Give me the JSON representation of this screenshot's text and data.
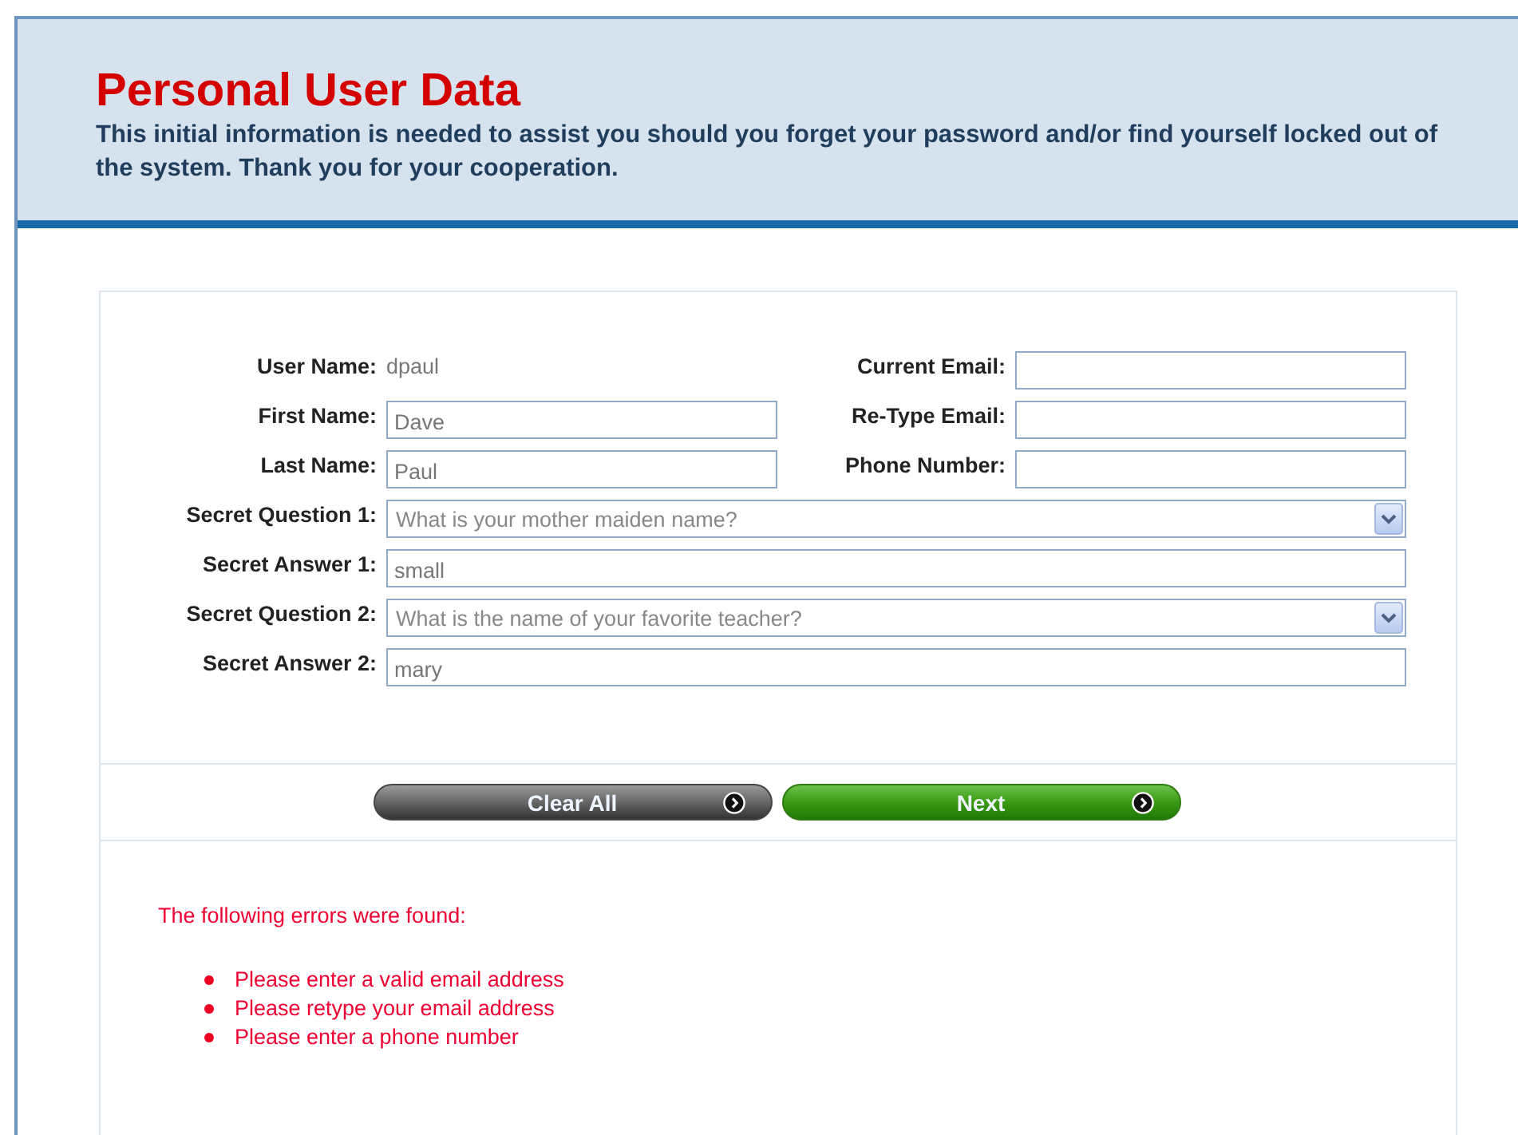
{
  "header": {
    "title": "Personal User Data",
    "description": "This initial information is needed to assist you should you forget your password and/or find yourself locked out of the system. Thank you for your cooperation."
  },
  "left_fields": [
    {
      "label": "User Name:",
      "kind": "static",
      "value": "dpaul"
    },
    {
      "label": "First Name:",
      "kind": "text",
      "value": "Dave"
    },
    {
      "label": "Last Name:",
      "kind": "text",
      "value": "Paul"
    }
  ],
  "right_fields": [
    {
      "label": "Current Email:",
      "kind": "text"
    },
    {
      "label": "Re-Type Email:",
      "kind": "text"
    },
    {
      "label": "Phone Number:",
      "kind": "text"
    }
  ],
  "wide_fields": [
    {
      "label": "Secret Question 1:",
      "kind": "select",
      "value": "What is your mother maiden name?"
    },
    {
      "label": "Secret Answer 1:",
      "kind": "text",
      "value": "small"
    },
    {
      "label": "Secret Question 2:",
      "kind": "select",
      "value": "What is the name of your favorite teacher?"
    },
    {
      "label": "Secret Answer 2:",
      "kind": "text",
      "value": "mary"
    }
  ],
  "buttons": [
    {
      "label": "Clear All",
      "kind": "secondary"
    },
    {
      "label": "Next",
      "kind": "primary"
    }
  ],
  "errors": {
    "title": "The following errors were found:",
    "items": [
      "Please enter a valid email address",
      "Please retype your email address",
      "Please enter a phone number"
    ]
  }
}
